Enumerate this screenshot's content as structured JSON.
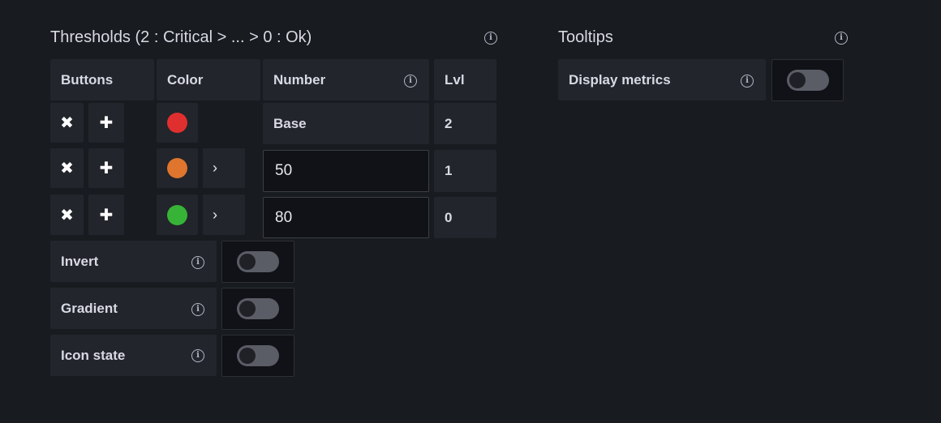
{
  "thresholds": {
    "title": "Thresholds (2 : Critical > ... > 0 : Ok)",
    "headers": {
      "buttons": "Buttons",
      "color": "Color",
      "number": "Number",
      "lvl": "Lvl"
    },
    "rows": [
      {
        "remove_glyph": "✖",
        "add_glyph": "✚",
        "color": "#e02f2f",
        "chevron": "",
        "number": "Base",
        "lvl": "2"
      },
      {
        "remove_glyph": "✖",
        "add_glyph": "✚",
        "color": "#e0752d",
        "chevron": "›",
        "number": "50",
        "lvl": "1"
      },
      {
        "remove_glyph": "✖",
        "add_glyph": "✚",
        "color": "#37b437",
        "chevron": "›",
        "number": "80",
        "lvl": "0"
      }
    ],
    "options": [
      {
        "label": "Invert",
        "enabled": false
      },
      {
        "label": "Gradient",
        "enabled": false
      },
      {
        "label": "Icon state",
        "enabled": false
      }
    ]
  },
  "tooltips": {
    "title": "Tooltips",
    "options": [
      {
        "label": "Display metrics",
        "enabled": false
      }
    ]
  },
  "icons": {
    "info": "i"
  },
  "colors": {
    "background": "#181b1f",
    "cell": "#22252b",
    "input": "#111217",
    "toggle_off": "#5a5d66"
  }
}
